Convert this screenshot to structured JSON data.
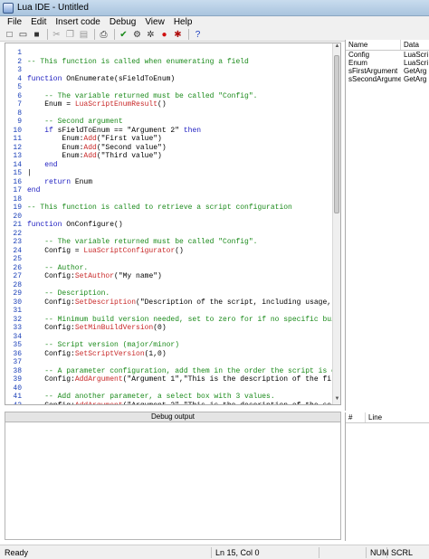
{
  "window": {
    "title": "Lua IDE - Untitled"
  },
  "menu": [
    "File",
    "Edit",
    "Insert code",
    "Debug",
    "View",
    "Help"
  ],
  "toolbar": [
    {
      "icon": "new-file-icon",
      "glyph": "□"
    },
    {
      "icon": "open-folder-icon",
      "glyph": "▭"
    },
    {
      "icon": "save-icon",
      "glyph": "■"
    },
    {
      "sep": true
    },
    {
      "icon": "cut-icon",
      "glyph": "✂"
    },
    {
      "icon": "copy-icon",
      "glyph": "❐"
    },
    {
      "icon": "paste-icon",
      "glyph": "▤"
    },
    {
      "sep": true
    },
    {
      "icon": "print-icon",
      "glyph": "⎙"
    },
    {
      "sep": true
    },
    {
      "icon": "check-syntax-icon",
      "glyph": "✔"
    },
    {
      "icon": "gear-icon",
      "glyph": "⚙"
    },
    {
      "icon": "gear-run-icon",
      "glyph": "✲"
    },
    {
      "icon": "breakpoint-icon",
      "glyph": "●"
    },
    {
      "icon": "bug-icon",
      "glyph": "✱"
    },
    {
      "sep": true
    },
    {
      "icon": "help-icon",
      "glyph": "?"
    }
  ],
  "code": [
    {
      "n": "1",
      "parts": []
    },
    {
      "n": "2",
      "parts": [
        {
          "c": "cm",
          "t": "-- This function is called when enumerating a field"
        }
      ]
    },
    {
      "n": "3",
      "parts": []
    },
    {
      "n": "4",
      "parts": [
        {
          "c": "kw",
          "t": "function"
        },
        {
          "c": "txt",
          "t": " OnEnumerate(sFieldToEnum)"
        }
      ]
    },
    {
      "n": "5",
      "parts": []
    },
    {
      "n": "6",
      "parts": [
        {
          "c": "cm",
          "t": "    -- The variable returned must be called \"Config\"."
        }
      ]
    },
    {
      "n": "7",
      "parts": [
        {
          "c": "txt",
          "t": "    Enum = "
        },
        {
          "c": "fn",
          "t": "LuaScriptEnumResult"
        },
        {
          "c": "txt",
          "t": "()"
        }
      ]
    },
    {
      "n": "8",
      "parts": []
    },
    {
      "n": "9",
      "parts": [
        {
          "c": "cm",
          "t": "    -- Second argument"
        }
      ]
    },
    {
      "n": "10",
      "parts": [
        {
          "c": "kw",
          "t": "    if"
        },
        {
          "c": "txt",
          "t": " sFieldToEnum == \"Argument 2\" "
        },
        {
          "c": "kw",
          "t": "then"
        }
      ]
    },
    {
      "n": "11",
      "parts": [
        {
          "c": "txt",
          "t": "        Enum:"
        },
        {
          "c": "fn",
          "t": "Add"
        },
        {
          "c": "txt",
          "t": "(\"First value\")"
        }
      ]
    },
    {
      "n": "12",
      "parts": [
        {
          "c": "txt",
          "t": "        Enum:"
        },
        {
          "c": "fn",
          "t": "Add"
        },
        {
          "c": "txt",
          "t": "(\"Second value\")"
        }
      ]
    },
    {
      "n": "13",
      "parts": [
        {
          "c": "txt",
          "t": "        Enum:"
        },
        {
          "c": "fn",
          "t": "Add"
        },
        {
          "c": "txt",
          "t": "(\"Third value\")"
        }
      ]
    },
    {
      "n": "14",
      "parts": [
        {
          "c": "kw",
          "t": "    end"
        }
      ]
    },
    {
      "n": "15",
      "parts": [
        {
          "c": "txt",
          "t": "|"
        }
      ]
    },
    {
      "n": "16",
      "parts": [
        {
          "c": "kw",
          "t": "    return"
        },
        {
          "c": "txt",
          "t": " Enum"
        }
      ]
    },
    {
      "n": "17",
      "parts": [
        {
          "c": "kw",
          "t": "end"
        }
      ]
    },
    {
      "n": "18",
      "parts": []
    },
    {
      "n": "19",
      "parts": [
        {
          "c": "cm",
          "t": "-- This function is called to retrieve a script configuration"
        }
      ]
    },
    {
      "n": "20",
      "parts": []
    },
    {
      "n": "21",
      "parts": [
        {
          "c": "kw",
          "t": "function"
        },
        {
          "c": "txt",
          "t": " OnConfigure()"
        }
      ]
    },
    {
      "n": "22",
      "parts": []
    },
    {
      "n": "23",
      "parts": [
        {
          "c": "cm",
          "t": "    -- The variable returned must be called \"Config\"."
        }
      ]
    },
    {
      "n": "24",
      "parts": [
        {
          "c": "txt",
          "t": "    Config = "
        },
        {
          "c": "fn",
          "t": "LuaScriptConfigurator"
        },
        {
          "c": "txt",
          "t": "()"
        }
      ]
    },
    {
      "n": "25",
      "parts": []
    },
    {
      "n": "26",
      "parts": [
        {
          "c": "cm",
          "t": "    -- Author."
        }
      ]
    },
    {
      "n": "27",
      "parts": [
        {
          "c": "txt",
          "t": "    Config:"
        },
        {
          "c": "fn",
          "t": "SetAuthor"
        },
        {
          "c": "txt",
          "t": "(\"My name\")"
        }
      ]
    },
    {
      "n": "28",
      "parts": []
    },
    {
      "n": "29",
      "parts": [
        {
          "c": "cm",
          "t": "    -- Description."
        }
      ]
    },
    {
      "n": "30",
      "parts": [
        {
          "c": "txt",
          "t": "    Config:"
        },
        {
          "c": "fn",
          "t": "SetDescription"
        },
        {
          "c": "txt",
          "t": "(\"Description of the script, including usage,"
        }
      ]
    },
    {
      "n": "31",
      "parts": []
    },
    {
      "n": "32",
      "parts": [
        {
          "c": "cm",
          "t": "    -- Minimum build version needed, set to zero for if no specific buil"
        }
      ]
    },
    {
      "n": "33",
      "parts": [
        {
          "c": "txt",
          "t": "    Config:"
        },
        {
          "c": "fn",
          "t": "SetMinBuildVersion"
        },
        {
          "c": "txt",
          "t": "(0)"
        }
      ]
    },
    {
      "n": "34",
      "parts": []
    },
    {
      "n": "35",
      "parts": [
        {
          "c": "cm",
          "t": "    -- Script version (major/minor)"
        }
      ]
    },
    {
      "n": "36",
      "parts": [
        {
          "c": "txt",
          "t": "    Config:"
        },
        {
          "c": "fn",
          "t": "SetScriptVersion"
        },
        {
          "c": "txt",
          "t": "(1,0)"
        }
      ]
    },
    {
      "n": "37",
      "parts": []
    },
    {
      "n": "38",
      "parts": [
        {
          "c": "cm",
          "t": "    -- A parameter configuration, add them in the order the script is e"
        }
      ]
    },
    {
      "n": "39",
      "parts": [
        {
          "c": "txt",
          "t": "    Config:"
        },
        {
          "c": "fn",
          "t": "AddArgument"
        },
        {
          "c": "txt",
          "t": "(\"Argument 1\",\"This is the description of the fir"
        }
      ]
    },
    {
      "n": "40",
      "parts": []
    },
    {
      "n": "41",
      "parts": [
        {
          "c": "cm",
          "t": "    -- Add another parameter, a select box with 3 values."
        }
      ]
    },
    {
      "n": "42",
      "parts": [
        {
          "c": "txt",
          "t": "    Config:"
        },
        {
          "c": "fn",
          "t": "AddArgument"
        },
        {
          "c": "txt",
          "t": "(\"Argument 2\",\"This is the description of the sec"
        }
      ]
    }
  ],
  "variables": {
    "headers": [
      "Name",
      "Data"
    ],
    "rows": [
      [
        "Config",
        "LuaScri"
      ],
      [
        "Enum",
        "LuaScri"
      ],
      [
        "sFirstArgument",
        "GetArg"
      ],
      [
        "sSecondArgume...",
        "GetArg"
      ]
    ]
  },
  "debug": {
    "title": "Debug output"
  },
  "errors": {
    "headers": [
      "#",
      "Line"
    ]
  },
  "status": {
    "ready": "Ready",
    "position": "Ln 15, Col 0",
    "num": "NUM",
    "scrl": "SCRL"
  }
}
